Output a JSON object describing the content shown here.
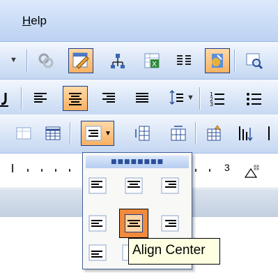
{
  "menubar": {
    "help_label": "Help"
  },
  "tooltip": {
    "text": "Align Center"
  },
  "ruler": {
    "number": "3"
  },
  "icons": {
    "toolbar1": [
      "link-icon",
      "edit-pen-icon",
      "document-map-icon",
      "insert-excel-icon",
      "columns-icon",
      "drawing-icon",
      "zoom-icon"
    ],
    "toolbar2": [
      "underline-icon",
      "align-left-icon",
      "align-center-icon",
      "align-right-icon",
      "justify-icon",
      "line-spacing-icon",
      "numbering-icon",
      "bullets-icon"
    ],
    "toolbar3": [
      "draw-table-icon",
      "insert-table-icon",
      "cell-alignment-icon",
      "distribute-rows-icon",
      "distribute-columns-icon",
      "table-autoformat-icon",
      "sort-icon"
    ]
  },
  "cell_alignment": {
    "options": [
      "top-left",
      "top-center",
      "top-right",
      "middle-left",
      "middle-center",
      "middle-right",
      "bottom-left",
      "bottom-center",
      "bottom-right"
    ],
    "selected": "middle-center"
  },
  "colors": {
    "toolbar_blue": "#c4d7f2",
    "active_orange": "#f7b162",
    "selected_orange": "#f08a3c",
    "tooltip_bg": "#ffffe1"
  }
}
